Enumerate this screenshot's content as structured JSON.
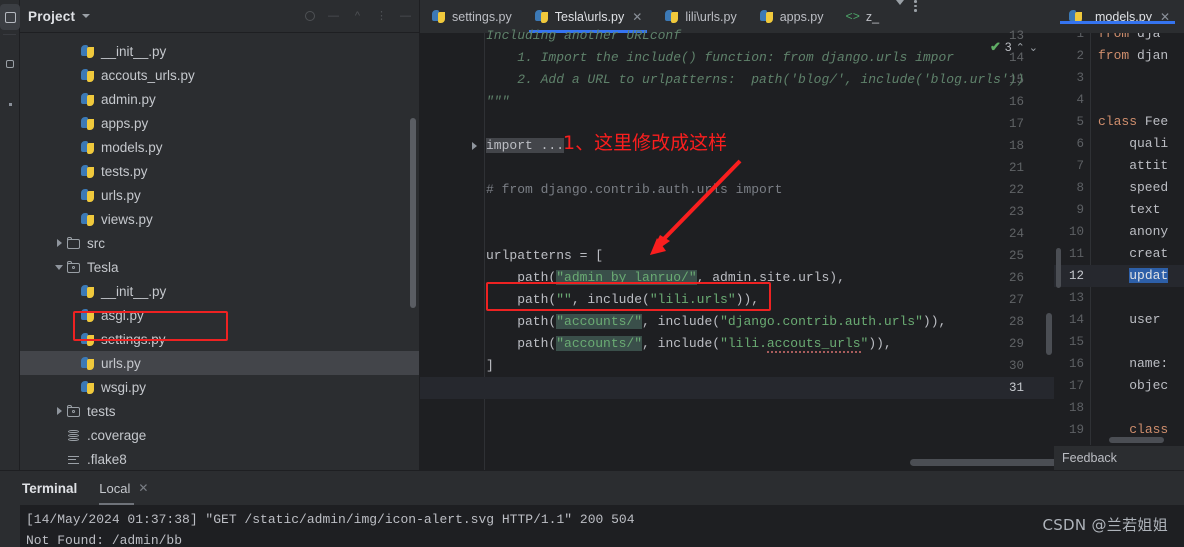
{
  "rail": {
    "items": [
      {
        "name": "project-tool-window-icon",
        "icon": "window-box-icon",
        "selected": true
      },
      {
        "name": "structure-tool-window-icon",
        "icon": "small-box-icon",
        "selected": false
      },
      {
        "name": "bookmarks-tool-window-icon",
        "icon": "dot-icon",
        "selected": false
      }
    ]
  },
  "project": {
    "title": "Project",
    "header_icons": [
      "circle-icon",
      "collapse-icon",
      "expand-icon",
      "settings-icon",
      "hide-icon"
    ],
    "tree": [
      {
        "label": "__init__.py",
        "icon": "python-file-icon",
        "indent": 3,
        "twisty": "none"
      },
      {
        "label": "accouts_urls.py",
        "icon": "python-file-icon",
        "indent": 3,
        "twisty": "none"
      },
      {
        "label": "admin.py",
        "icon": "python-file-icon",
        "indent": 3,
        "twisty": "none"
      },
      {
        "label": "apps.py",
        "icon": "python-file-icon",
        "indent": 3,
        "twisty": "none"
      },
      {
        "label": "models.py",
        "icon": "python-file-icon",
        "indent": 3,
        "twisty": "none"
      },
      {
        "label": "tests.py",
        "icon": "python-file-icon",
        "indent": 3,
        "twisty": "none"
      },
      {
        "label": "urls.py",
        "icon": "python-file-icon",
        "indent": 3,
        "twisty": "none"
      },
      {
        "label": "views.py",
        "icon": "python-file-icon",
        "indent": 3,
        "twisty": "none"
      },
      {
        "label": "src",
        "icon": "folder-icon",
        "indent": 2,
        "twisty": "collapsed"
      },
      {
        "label": "Tesla",
        "icon": "module-folder-icon",
        "indent": 2,
        "twisty": "expanded"
      },
      {
        "label": "__init__.py",
        "icon": "python-file-icon",
        "indent": 3,
        "twisty": "none"
      },
      {
        "label": "asgi.py",
        "icon": "python-file-icon",
        "indent": 3,
        "twisty": "none"
      },
      {
        "label": "settings.py",
        "icon": "python-file-icon",
        "indent": 3,
        "twisty": "none"
      },
      {
        "label": "urls.py",
        "icon": "python-file-icon",
        "indent": 3,
        "twisty": "none",
        "selected": true,
        "annotated": true
      },
      {
        "label": "wsgi.py",
        "icon": "python-file-icon",
        "indent": 3,
        "twisty": "none"
      },
      {
        "label": "tests",
        "icon": "module-folder-icon",
        "indent": 2,
        "twisty": "collapsed"
      },
      {
        "label": ".coverage",
        "icon": "database-file-icon",
        "indent": 2,
        "twisty": "none"
      },
      {
        "label": ".flake8",
        "icon": "text-file-icon",
        "indent": 2,
        "twisty": "none"
      }
    ]
  },
  "editor_tabs": [
    {
      "label": "settings.py",
      "icon": "python-file-icon",
      "active": false,
      "closable": false
    },
    {
      "label": "Tesla\\urls.py",
      "icon": "python-file-icon",
      "active": true,
      "closable": true
    },
    {
      "label": "lili\\urls.py",
      "icon": "python-file-icon",
      "active": false,
      "closable": false
    },
    {
      "label": "apps.py",
      "icon": "python-file-icon",
      "active": false,
      "closable": false
    },
    {
      "label": "z_",
      "icon": "html-file-icon",
      "active": false,
      "closable": false
    }
  ],
  "editor": {
    "inspection": {
      "count": "3",
      "status_icon": "green-check-icon"
    },
    "lines": [
      {
        "num": "13",
        "text": "Including another URLconf",
        "style": "doc",
        "partial": true
      },
      {
        "num": "14",
        "text": "    1. Import the include() function: from django.urls impor",
        "style": "doc"
      },
      {
        "num": "15",
        "text": "    2. Add a URL to urlpatterns:  path('blog/', include('blog.urls'))",
        "style": "doc"
      },
      {
        "num": "16",
        "text": "\"\"\"",
        "style": "doc"
      },
      {
        "num": "17",
        "text": "",
        "style": "plain"
      },
      {
        "num": "18",
        "text": "import ...",
        "style": "folded",
        "fold": true
      },
      {
        "num": "21",
        "text": "",
        "style": "plain"
      },
      {
        "num": "22",
        "text": "# from django.contrib.auth.urls import",
        "style": "comment"
      },
      {
        "num": "23",
        "text": "",
        "style": "plain"
      },
      {
        "num": "24",
        "text": "",
        "style": "plain"
      },
      {
        "num": "25",
        "text": "urlpatterns = [",
        "style": "code"
      },
      {
        "num": "26",
        "text": "    path(\"admin_by_lanruo/\", admin.site.urls),",
        "style": "code"
      },
      {
        "num": "27",
        "text": "    path(\"\", include(\"lili.urls\")),",
        "style": "code"
      },
      {
        "num": "28",
        "text": "    path(\"accounts/\", include(\"django.contrib.auth.urls\")),",
        "style": "code"
      },
      {
        "num": "29",
        "text": "    path(\"accounts/\", include(\"lili.accouts_urls\")),",
        "style": "code"
      },
      {
        "num": "30",
        "text": "]",
        "style": "code"
      },
      {
        "num": "31",
        "text": "",
        "style": "plain",
        "current": true
      }
    ]
  },
  "annotations": [
    {
      "name": "edit-here-note",
      "text": "1、这里修改成这样",
      "color": "#fa1e1e"
    }
  ],
  "right_editor": {
    "tab": {
      "label": "models.py",
      "icon": "python-file-icon",
      "closable": true
    },
    "lines": [
      {
        "num": "1",
        "text": "from dja",
        "style": "kw-from",
        "partial": true
      },
      {
        "num": "2",
        "text": "from djan",
        "style": "kw-from"
      },
      {
        "num": "3",
        "text": "",
        "style": "plain"
      },
      {
        "num": "4",
        "text": "",
        "style": "plain"
      },
      {
        "num": "5",
        "text": "class Fee",
        "style": "kw-class"
      },
      {
        "num": "6",
        "text": "    quali",
        "style": "plain"
      },
      {
        "num": "7",
        "text": "    attit",
        "style": "plain"
      },
      {
        "num": "8",
        "text": "    speed",
        "style": "plain"
      },
      {
        "num": "9",
        "text": "    text",
        "style": "plain"
      },
      {
        "num": "10",
        "text": "    anony",
        "style": "plain"
      },
      {
        "num": "11",
        "text": "    creat",
        "style": "plain"
      },
      {
        "num": "12",
        "text": "    updat",
        "style": "selected",
        "current": true
      },
      {
        "num": "13",
        "text": "",
        "style": "plain"
      },
      {
        "num": "14",
        "text": "    user",
        "style": "plain"
      },
      {
        "num": "15",
        "text": "",
        "style": "plain"
      },
      {
        "num": "16",
        "text": "    name:",
        "style": "plain"
      },
      {
        "num": "17",
        "text": "    objec",
        "style": "plain"
      },
      {
        "num": "18",
        "text": "",
        "style": "plain"
      },
      {
        "num": "19",
        "text": "    class",
        "style": "kw-class"
      }
    ],
    "feedback_label": "Feedback"
  },
  "terminal": {
    "title": "Terminal",
    "session_label": "Local",
    "output": [
      "[14/May/2024 01:37:38] \"GET /static/admin/img/icon-alert.svg HTTP/1.1\" 200 504",
      "Not Found: /admin/bb"
    ]
  },
  "watermark": {
    "text": "CSDN @兰若姐姐"
  },
  "colors": {
    "accent": "#3574f0",
    "annotation_red": "#fa1e1e",
    "background": "#2b2d30",
    "editor_background": "#1e1f22",
    "string_green": "#6aab73",
    "keyword_orange": "#cf8e6d",
    "doc_green": "#5f826b",
    "selection_blue": "#2d5fa8"
  }
}
